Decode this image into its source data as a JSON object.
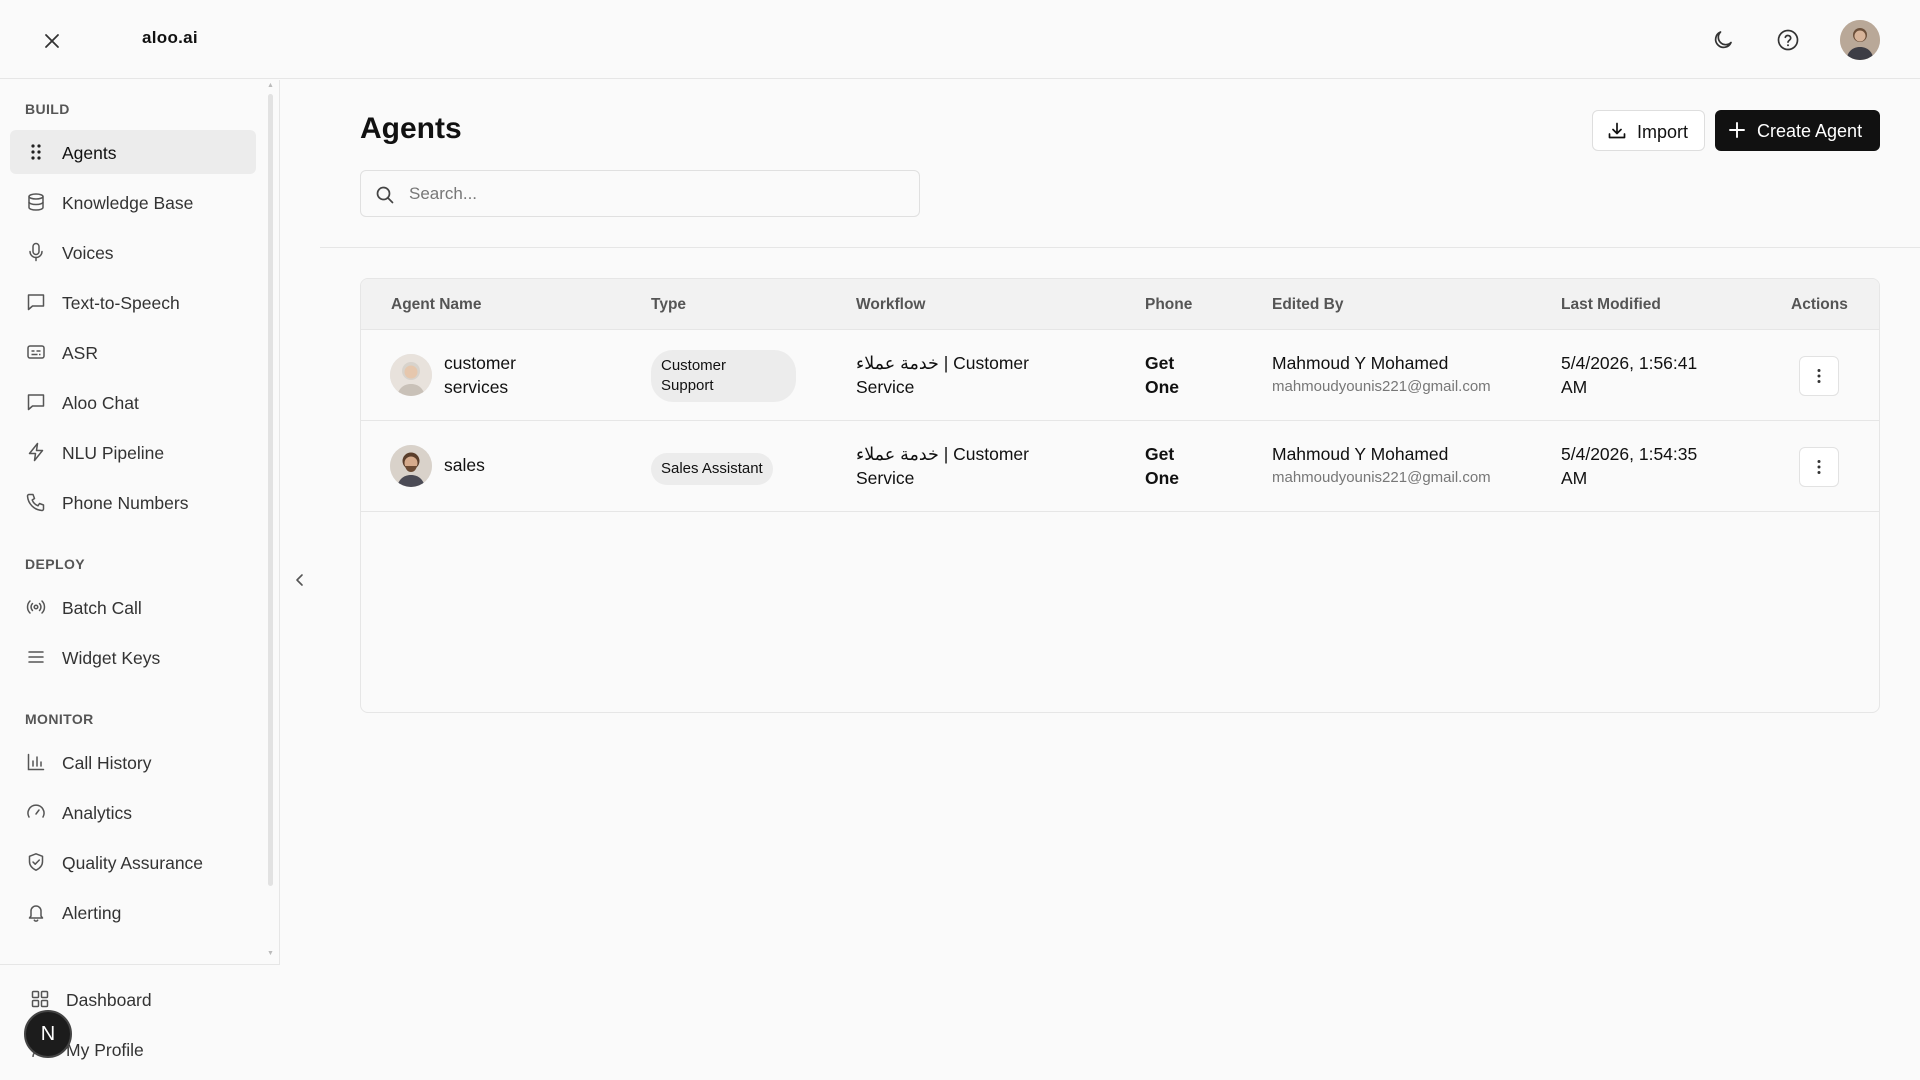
{
  "app": {
    "brand": "aloo.ai"
  },
  "sidebar": {
    "sections": [
      {
        "label": "BUILD",
        "items": [
          {
            "label": "Agents",
            "icon": "grip-dots-icon",
            "active": true
          },
          {
            "label": "Knowledge Base",
            "icon": "database-icon"
          },
          {
            "label": "Voices",
            "icon": "microphone-icon"
          },
          {
            "label": "Text-to-Speech",
            "icon": "message-square-icon"
          },
          {
            "label": "ASR",
            "icon": "captions-icon"
          },
          {
            "label": "Aloo Chat",
            "icon": "chat-bubble-icon"
          },
          {
            "label": "NLU Pipeline",
            "icon": "lightning-icon"
          },
          {
            "label": "Phone Numbers",
            "icon": "phone-icon"
          }
        ]
      },
      {
        "label": "DEPLOY",
        "items": [
          {
            "label": "Batch Call",
            "icon": "broadcast-icon"
          },
          {
            "label": "Widget Keys",
            "icon": "menu-lines-icon"
          }
        ]
      },
      {
        "label": "MONITOR",
        "items": [
          {
            "label": "Call History",
            "icon": "bar-chart-icon"
          },
          {
            "label": "Analytics",
            "icon": "gauge-icon"
          },
          {
            "label": "Quality Assurance",
            "icon": "shield-check-icon"
          },
          {
            "label": "Alerting",
            "icon": "bell-icon"
          }
        ]
      }
    ],
    "bottom": [
      {
        "label": "Dashboard",
        "icon": "grid-icon"
      },
      {
        "label": "My Profile",
        "icon": "user-icon"
      }
    ],
    "badge_letter": "N"
  },
  "main": {
    "title": "Agents",
    "import_label": "Import",
    "create_label": "Create Agent",
    "search_placeholder": "Search...",
    "table": {
      "columns": [
        "Agent Name",
        "Type",
        "Workflow",
        "Phone",
        "Edited By",
        "Last Modified",
        "Actions"
      ],
      "rows": [
        {
          "name_line1": "customer",
          "name_line2": "services",
          "type_line1": "Customer",
          "type_line2": "Support",
          "workflow_line1": "خدمة عملاء | Customer",
          "workflow_line2": "Service",
          "phone_line1": "Get",
          "phone_line2": "One",
          "editor": "Mahmoud Y Mohamed",
          "email": "mahmoudyounis221@gmail.com",
          "modified_line1": "5/4/2026, 1:56:41",
          "modified_line2": "AM"
        },
        {
          "name_line1": "sales",
          "name_line2": "",
          "type_line1": "Sales Assistant",
          "type_line2": "",
          "workflow_line1": "خدمة عملاء | Customer",
          "workflow_line2": "Service",
          "phone_line1": "Get",
          "phone_line2": "One",
          "editor": "Mahmoud Y Mohamed",
          "email": "mahmoudyounis221@gmail.com",
          "modified_line1": "5/4/2026, 1:54:35",
          "modified_line2": "AM"
        }
      ]
    }
  },
  "colors": {
    "primary_button": "#111111",
    "active_nav_bg": "#ececec",
    "border": "#e6e6e6"
  }
}
